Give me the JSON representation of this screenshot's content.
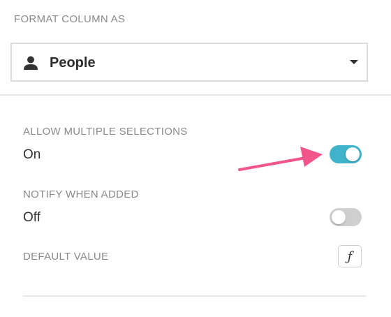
{
  "format_column": {
    "label": "FORMAT COLUMN AS",
    "selected": "People",
    "icon": "person-icon"
  },
  "options": {
    "allow_multiple": {
      "label": "ALLOW MULTIPLE SELECTIONS",
      "state": "On",
      "enabled": true
    },
    "notify_when_added": {
      "label": "NOTIFY WHEN ADDED",
      "state": "Off",
      "enabled": false
    },
    "default_value": {
      "label": "DEFAULT VALUE",
      "button_glyph": "ƒ"
    }
  },
  "colors": {
    "toggle_on": "#3fb3c9",
    "toggle_off": "#cfcfcf",
    "annotation_arrow": "#f0568a"
  }
}
